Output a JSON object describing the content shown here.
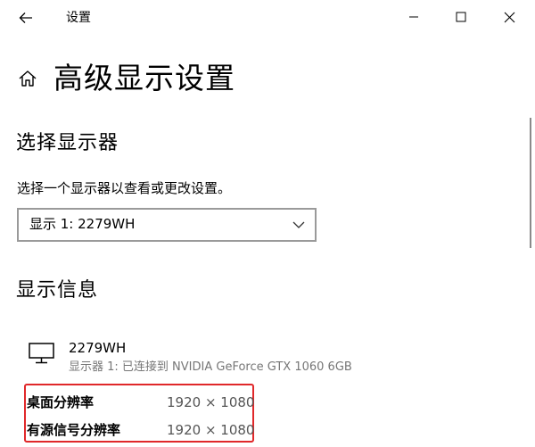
{
  "window": {
    "title": "设置"
  },
  "page": {
    "title": "高级显示设置"
  },
  "select_display": {
    "heading": "选择显示器",
    "description": "选择一个显示器以查看或更改设置。",
    "dropdown_value": "显示 1: 2279WH"
  },
  "display_info": {
    "heading": "显示信息",
    "monitor_name": "2279WH",
    "connection": "显示器 1: 已连接到 NVIDIA GeForce GTX 1060 6GB",
    "rows": [
      {
        "label": "桌面分辨率",
        "value": "1920 × 1080"
      },
      {
        "label": "有源信号分辨率",
        "value": "1920 × 1080"
      }
    ]
  },
  "colors": {
    "highlight_border": "#e0282a",
    "secondary_text": "#767676"
  },
  "icons": {
    "back": "back-arrow-icon",
    "minimize": "minimize-icon",
    "maximize": "maximize-icon",
    "close": "close-icon",
    "home": "home-icon",
    "chevron": "chevron-down-icon",
    "monitor": "monitor-icon"
  }
}
